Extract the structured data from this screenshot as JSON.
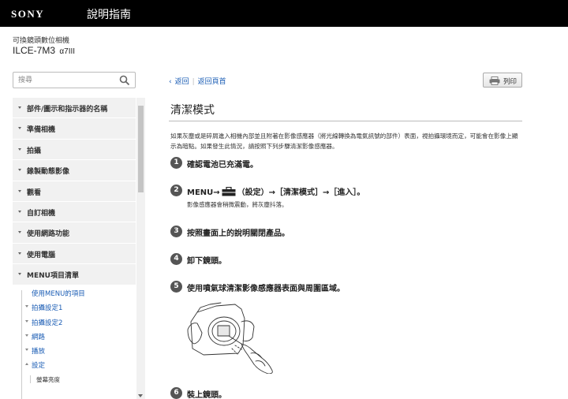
{
  "header": {
    "brand": "SONY",
    "guide_title": "說明指南"
  },
  "product": {
    "category": "可換鏡頭數位相機",
    "model": "ILCE-7M3",
    "model_sub": "α7III"
  },
  "search": {
    "placeholder": "搜尋"
  },
  "sidebar": {
    "items": [
      {
        "label": "部件/圖示和指示器的名稱"
      },
      {
        "label": "準備相機"
      },
      {
        "label": "拍攝"
      },
      {
        "label": "錄製動態影像"
      },
      {
        "label": "觀看"
      },
      {
        "label": "自訂相機"
      },
      {
        "label": "使用網路功能"
      },
      {
        "label": "使用電腦"
      },
      {
        "label": "MENU項目清單"
      }
    ],
    "subitems": [
      {
        "label": "使用MENU的項目"
      },
      {
        "label": "拍攝設定1"
      },
      {
        "label": "拍攝設定2"
      },
      {
        "label": "網路"
      },
      {
        "label": "播放"
      },
      {
        "label": "設定"
      },
      {
        "label": "螢幕亮度"
      }
    ]
  },
  "breadcrumb": {
    "back": "返回",
    "home": "返回頁首"
  },
  "print_label": "列印",
  "page_title": "清潔模式",
  "intro": "如果灰塵或是碎屑進入相機內部並且附著在影像感應器（將光線轉換為電氣訊號的部件）表面，視拍攝環境而定，可能會在影像上顯示為暗點。如果發生此情況，請按照下列步驟清潔影像感應器。",
  "steps": [
    {
      "num": "1",
      "text": "確認電池已充滿電。"
    },
    {
      "num": "2",
      "text_a": "MENU→",
      "text_b": "（設定）→［清潔模式］→［進入］。",
      "note": "影像感應器會稍微震動，將灰塵抖落。"
    },
    {
      "num": "3",
      "text": "按照畫面上的說明關閉產品。"
    },
    {
      "num": "4",
      "text": "卸下鏡頭。"
    },
    {
      "num": "5",
      "text": "使用噴氣球清潔影像感應器表面與周圍區域。"
    },
    {
      "num": "6",
      "text": "裝上鏡頭。"
    }
  ],
  "colors": {
    "topbar": "#000000",
    "link": "#1a5cb4",
    "step_circle": "#555555"
  }
}
